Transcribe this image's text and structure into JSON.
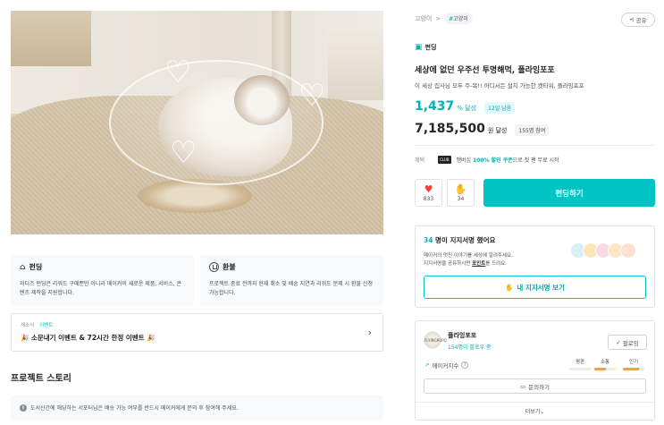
{
  "hero": {
    "alt": ""
  },
  "info": {
    "funding": {
      "title": "펀딩",
      "desc": "와디즈 펀딩은 리워드 구매뿐만 아니라 메이커의 새로운 제품, 서비스, 콘텐츠 제작을 지원합니다."
    },
    "refund": {
      "title": "환불",
      "desc": "프로젝트 종료 전까지 현재 취소 및 배송 지연과 리워드 문제 시 환불 신청 가능합니다."
    }
  },
  "event": {
    "crumb": "새소식",
    "crumb_active": "이벤트",
    "text": "🎉 소문내기 이벤트 & 72시간 한정 이벤트 🎉",
    "chevron": "›"
  },
  "story": {
    "title": "프로젝트 스토리"
  },
  "notice": {
    "icon": "i",
    "text": "도서산간에 해당하는 서포터님은 배송 가능 여부를 반드시 메이커에게 문의 후 참여해 주세요."
  },
  "right": {
    "breadcrumb": {
      "category": "고양이",
      "sep": ">",
      "tag": "고양이"
    },
    "share": "공유",
    "badge": "펀딩",
    "title": "세상에 없던 우주선 투명해먹, 플라잉포포",
    "subtitle": "이 세상 집사님 모두 주-목!! 어디서든 설치 가능한 캣타워, 플라잉포포",
    "percent": {
      "num": "1,437",
      "unit": "% 달성",
      "chip": "12일 남음"
    },
    "amount": {
      "num": "7,185,500",
      "unit": "원 달성",
      "chip": "155명 참여"
    },
    "benefit": {
      "label": "혜택",
      "club": "CLUB",
      "pre": "멤버십 ",
      "highlight": "100% 할인 쿠폰",
      "post": "으로 첫 팬 무료 시작"
    },
    "like_count": "833",
    "cheer_count": "34",
    "fund_button": "펀딩하기"
  },
  "supporters": {
    "count": "34",
    "head_rest": " 명이 지지서명 했어요",
    "line1": "메이커의 멋진 이야기를 세상에 알려주세요.",
    "line2_pre": "지지서명을 공유하시면 ",
    "line2_link": "포인트",
    "line2_post": "를 드려요.",
    "button": "내 지지서명 보기"
  },
  "maker": {
    "avatar_text": "FLYINGPOPO",
    "name": "플라잉포포",
    "followers": "154명이 팔로우 중",
    "follow_button": "팔로잉",
    "index_label": "메이커지수",
    "metrics": [
      {
        "label": "평판",
        "level": 0.0,
        "color": "#adb5bd"
      },
      {
        "label": "소통",
        "level": 0.55,
        "color": "#f5a623"
      },
      {
        "label": "인기",
        "level": 0.75,
        "color": "#f5a623"
      }
    ],
    "inquiry": "문의하기",
    "more": "더보기"
  },
  "colors": {
    "accent": "#00c4c4",
    "heart": "#f03e3e"
  }
}
